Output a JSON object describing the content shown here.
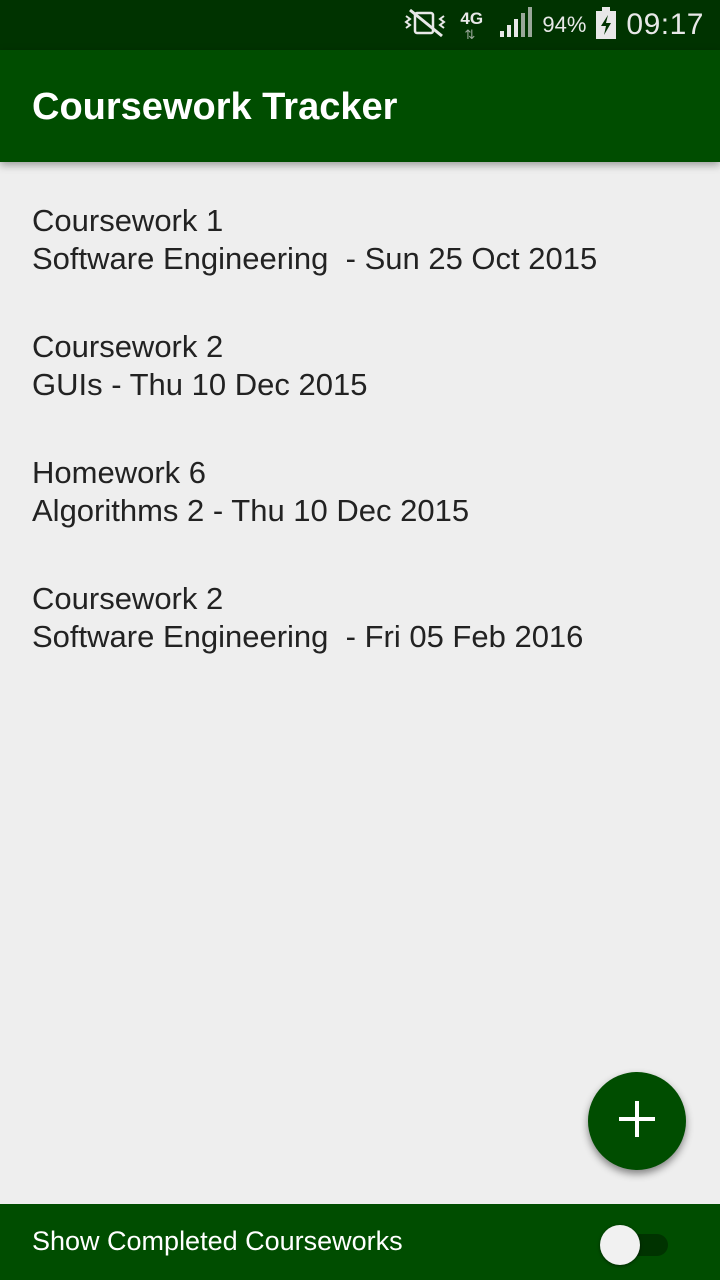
{
  "status_bar": {
    "network": "4G",
    "battery": "94%",
    "time": "09:17",
    "icons": [
      "vibrate-mute-icon",
      "network-arrows-icon",
      "signal-icon",
      "battery-charging-icon"
    ]
  },
  "app_bar": {
    "title": "Coursework Tracker"
  },
  "courseworks": [
    {
      "title": "Coursework 1",
      "subtitle": "Software Engineering  - Sun 25 Oct 2015"
    },
    {
      "title": "Coursework 2",
      "subtitle": "GUIs - Thu 10 Dec 2015"
    },
    {
      "title": "Homework 6",
      "subtitle": "Algorithms 2 - Thu 10 Dec 2015"
    },
    {
      "title": "Coursework 2",
      "subtitle": "Software Engineering  - Fri 05 Feb 2016"
    }
  ],
  "fab": {
    "icon": "plus-icon"
  },
  "bottom_bar": {
    "label": "Show Completed Courseworks",
    "toggle_on": false
  },
  "colors": {
    "status_bar": "#003300",
    "primary": "#004d00",
    "background": "#eeeeee",
    "text": "#222222"
  }
}
